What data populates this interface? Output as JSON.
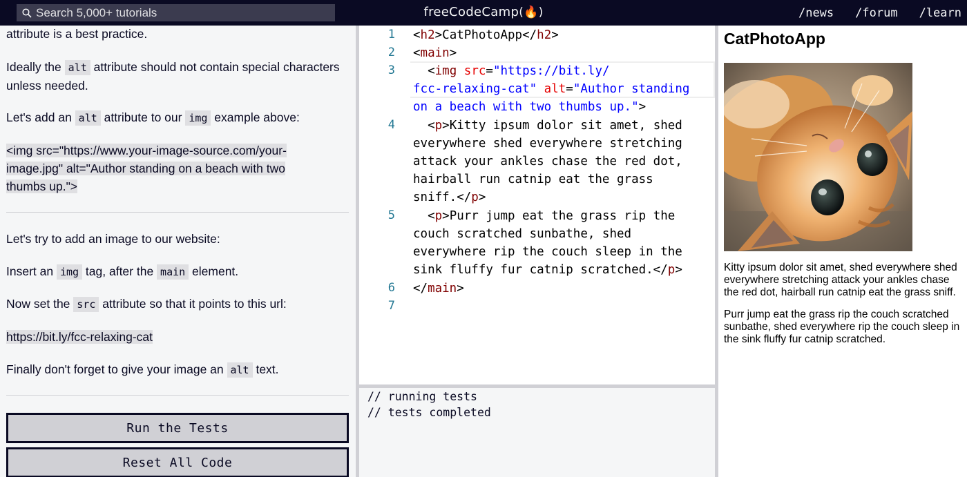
{
  "nav": {
    "search_placeholder": "Search 5,000+ tutorials",
    "logo_text": "freeCodeCamp",
    "logo_flame": "(🔥)",
    "links": [
      "/news",
      "/forum",
      "/learn"
    ]
  },
  "instructions": {
    "line_top": "attribute is a best practice.",
    "para1": {
      "pre": "Ideally the ",
      "code": "alt",
      "post": " attribute should not contain special characters unless needed."
    },
    "para2": {
      "pre": "Let's add an ",
      "code1": "alt",
      "mid": " attribute to our ",
      "code2": "img",
      "post": " example above:"
    },
    "code_block": [
      "<img src=\"https://www.your-image-source.com/your-",
      "image.jpg\" alt=\"Author standing on a beach with two",
      "thumbs up.\">"
    ],
    "para3": "Let's try to add an image to our website:",
    "para4": {
      "pre": "Insert an ",
      "code1": "img",
      "mid": " tag, after the ",
      "code2": "main",
      "post": " element."
    },
    "para5": {
      "pre": "Now set the ",
      "code": "src",
      "post": " attribute so that it points to this url:"
    },
    "url": "https://bit.ly/fcc-relaxing-cat",
    "para6": {
      "pre": "Finally don't forget to give your image an ",
      "code": "alt",
      "post": " text."
    },
    "run_button": "Run the Tests",
    "reset_button": "Reset All Code"
  },
  "editor": {
    "line_numbers": [
      "1",
      "2",
      "3",
      "4",
      "5",
      "6",
      "7"
    ],
    "l1": {
      "open": "<",
      "tag": "h2",
      "close": ">",
      "text": "CatPhotoApp",
      "open2": "</",
      "tag2": "h2",
      "close2": ">"
    },
    "l2": {
      "open": "<",
      "tag": "main",
      "close": ">"
    },
    "l3": {
      "indent": "  ",
      "open": "<",
      "tag": "img",
      "attr1": "src",
      "eq1": "=",
      "val1a": "\"https://bit.ly/",
      "val1b": "fcc-relaxing-cat\"",
      "attr2": "alt",
      "eq2": "=",
      "val2a": "\"Author standing",
      "val2b": "on a beach with two thumbs up.\"",
      "close": ">"
    },
    "l4": [
      "  <p>Kitty ipsum dolor sit amet, shed",
      "everywhere shed everywhere stretching",
      "attack your ankles chase the red dot,",
      "hairball run catnip eat the grass",
      "sniff.</p>"
    ],
    "l5": [
      "  <p>Purr jump eat the grass rip the",
      "couch scratched sunbathe, shed",
      "everywhere rip the couch sleep in the",
      "sink fluffy fur catnip scratched.</p>"
    ],
    "l6": {
      "open": "</",
      "tag": "main",
      "close": ">"
    }
  },
  "console": {
    "lines": [
      "// running tests",
      "// tests completed"
    ]
  },
  "preview": {
    "title": "CatPhotoApp",
    "p1": "Kitty ipsum dolor sit amet, shed everywhere shed everywhere stretching attack your ankles chase the red dot, hairball run catnip eat the grass sniff.",
    "p2": "Purr jump eat the grass rip the couch scratched sunbathe, shed everywhere rip the couch sleep in the sink fluffy fur catnip scratched."
  },
  "colors": {
    "nav_bg": "#0a0a23",
    "panel_bg": "#f5f6f7",
    "inline_code_bg": "#dfdfe2",
    "line_number": "#237893",
    "tag": "#800000",
    "attr": "#e50000",
    "string": "#0000ff"
  }
}
